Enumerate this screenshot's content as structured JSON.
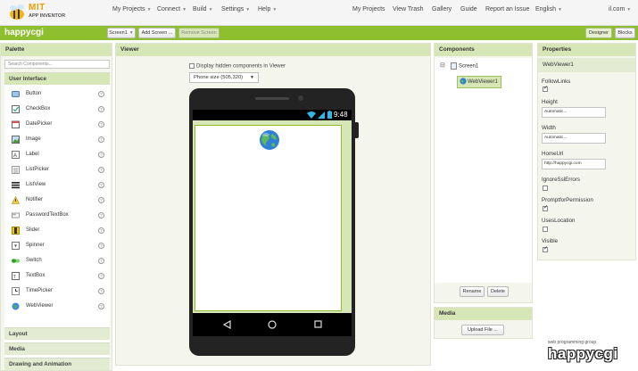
{
  "nav": {
    "logo_title": "MIT",
    "logo_subtitle": "APP INVENTOR",
    "my_projects": "My Projects",
    "connect": "Connect",
    "build": "Build",
    "settings": "Settings",
    "help": "Help",
    "my_projects_right": "My Projects",
    "view_trash": "View Trash",
    "gallery": "Gallery",
    "guide": "Guide",
    "report_issue": "Report an Issue",
    "language": "English",
    "account": "il.com"
  },
  "project_bar": {
    "name": "happycgi",
    "screen_select": "Screen1",
    "add_screen": "Add Screen ...",
    "remove_screen": "Remove Screen",
    "designer": "Designer",
    "blocks": "Blocks"
  },
  "palette": {
    "header": "Palette",
    "search_placeholder": "Search Components...",
    "user_interface": "User Interface",
    "items": [
      {
        "label": "Button",
        "icon": "button-icon"
      },
      {
        "label": "CheckBox",
        "icon": "checkbox-icon"
      },
      {
        "label": "DatePicker",
        "icon": "datepicker-icon"
      },
      {
        "label": "Image",
        "icon": "image-icon"
      },
      {
        "label": "Label",
        "icon": "label-icon"
      },
      {
        "label": "ListPicker",
        "icon": "listpicker-icon"
      },
      {
        "label": "ListView",
        "icon": "listview-icon"
      },
      {
        "label": "Notifier",
        "icon": "notifier-icon"
      },
      {
        "label": "PasswordTextBox",
        "icon": "password-icon"
      },
      {
        "label": "Slider",
        "icon": "slider-icon"
      },
      {
        "label": "Spinner",
        "icon": "spinner-icon"
      },
      {
        "label": "Switch",
        "icon": "switch-icon"
      },
      {
        "label": "TextBox",
        "icon": "textbox-icon"
      },
      {
        "label": "TimePicker",
        "icon": "timepicker-icon"
      },
      {
        "label": "WebViewer",
        "icon": "webviewer-icon"
      }
    ],
    "help_glyph": "?",
    "sections": [
      "Layout",
      "Media",
      "Drawing and Animation"
    ]
  },
  "viewer": {
    "header": "Viewer",
    "hidden_components_label": "Display hidden components in Viewer",
    "phone_size": "Phone size (505,320)",
    "clock": "9:48"
  },
  "components": {
    "header": "Components",
    "root": "Screen1",
    "child": "WebViewer1",
    "rename": "Rename",
    "delete": "Delete",
    "collapse_glyph": "⊟"
  },
  "media": {
    "header": "Media",
    "upload": "Upload File ..."
  },
  "properties": {
    "header": "Properties",
    "component": "WebViewer1",
    "follow_links_label": "FollowLinks",
    "follow_links": true,
    "height_label": "Height",
    "height_value": "Automatic...",
    "width_label": "Width",
    "width_value": "Automatic...",
    "home_url_label": "HomeUrl",
    "home_url_value": "http://happycgi.com",
    "ignore_ssl_label": "IgnoreSslErrors",
    "ignore_ssl": false,
    "prompt_permission_label": "PromptforPermission",
    "prompt_permission": true,
    "uses_location_label": "UsesLocation",
    "uses_location": false,
    "visible_label": "Visible",
    "visible": true
  },
  "watermark": {
    "tagline": "web programming group",
    "brand": "happycgi"
  },
  "colors": {
    "green_bar": "#8ebf2e",
    "panel_head": "#d6e6b7",
    "panel_bg": "#f4f6ee"
  }
}
